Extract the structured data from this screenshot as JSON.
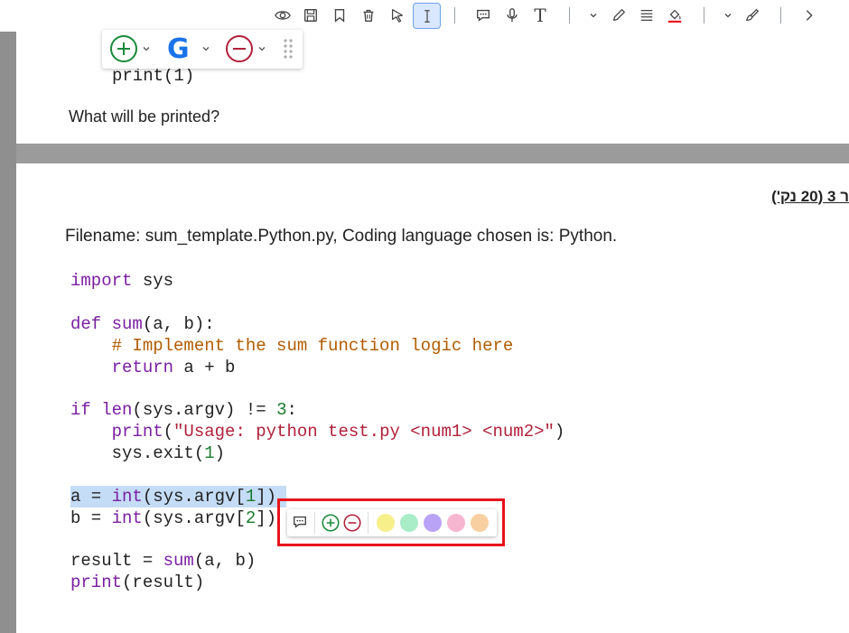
{
  "toolbar": {
    "items": [
      "eye-icon",
      "save-icon",
      "bookmark-icon",
      "trash-icon",
      "select-arrow-icon",
      "text-cursor-icon",
      "comment-icon",
      "microphone-icon",
      "text-tool-icon",
      "pen-icon",
      "align-icon",
      "fill-icon",
      "brush-icon",
      "chevron-right-icon"
    ],
    "text_tool_label": "T",
    "active_item": "text-cursor-icon"
  },
  "palette": {
    "google_label": "G"
  },
  "page1": {
    "code_tail": "print(1)",
    "question": "What will be printed?"
  },
  "page2": {
    "heading": "ר 3 (20 נק')",
    "filename_line": "Filename: sum_template.Python.py, Coding language chosen is: Python.",
    "code": {
      "l1_kw": "import",
      "l1_rest": " sys",
      "l2_kw": "def",
      "l2_fn": "sum",
      "l2_rest": "(a, b):",
      "l3": "    # Implement the sum function logic here",
      "l4_kw": "    return",
      "l4_rest": " a + b",
      "l5_kw": "if",
      "l5_fn": " len",
      "l5_rest": "(sys.argv) != ",
      "l5_num": "3",
      "l5_end": ":",
      "l6_fn": "    print",
      "l6_p1": "(",
      "l6_str": "\"Usage: python test.py <num1> <num2>\"",
      "l6_p2": ")",
      "l7_rest": "    sys.exit(",
      "l7_num": "1",
      "l7_end": ")",
      "l8_a": "a = ",
      "l8_fn": "int",
      "l8_b": "(sys.argv[",
      "l8_num": "1",
      "l8_c": "])",
      "l9_a": "b = ",
      "l9_fn": "int",
      "l9_b": "(sys.argv[",
      "l9_num": "2",
      "l9_c": "])",
      "l10_a": "result = ",
      "l10_fn": "sum",
      "l10_b": "(a, b)",
      "l11_fn": "print",
      "l11_b": "(result)"
    }
  },
  "selection_popup": {
    "colors": [
      "#f7ef8a",
      "#a8ecc8",
      "#b9a3f7",
      "#f7b6cf",
      "#f8cfa0"
    ]
  },
  "colors": {
    "accent_red": "#e8141c",
    "active_blue": "#6ea1e8"
  }
}
